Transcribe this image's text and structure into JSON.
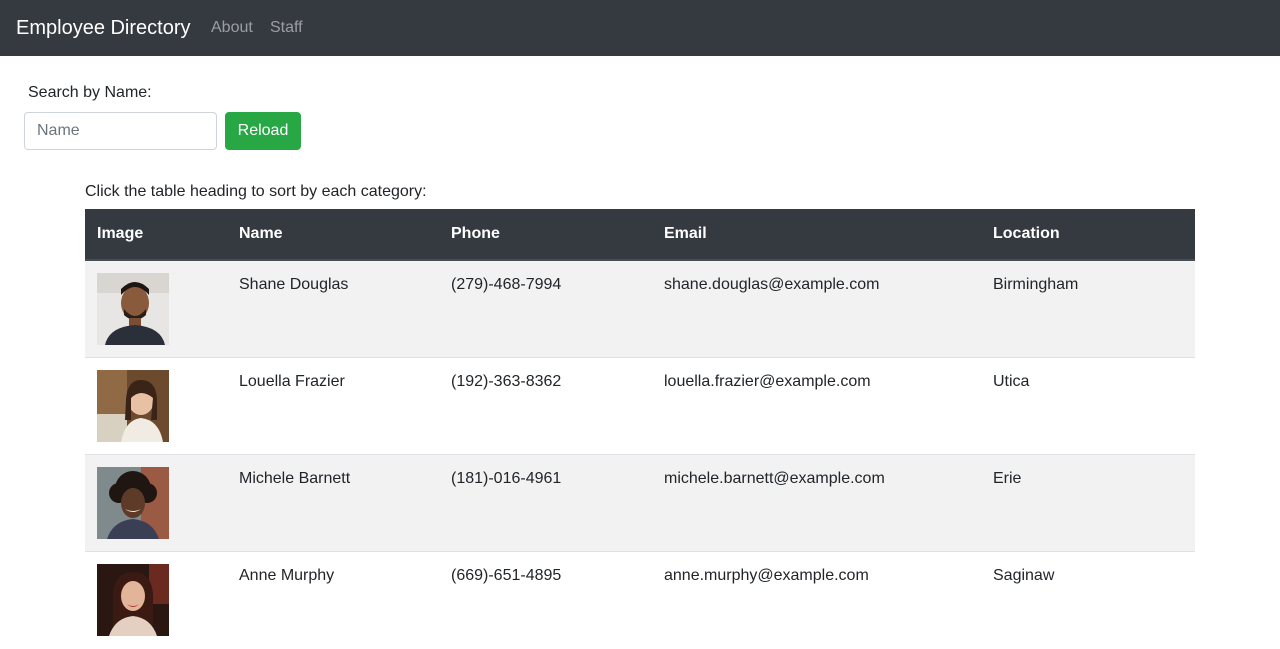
{
  "navbar": {
    "brand": "Employee Directory",
    "links": [
      {
        "label": "About"
      },
      {
        "label": "Staff"
      }
    ]
  },
  "search": {
    "label": "Search by Name:",
    "placeholder": "Name",
    "value": "",
    "reload_label": "Reload"
  },
  "instructions": "Click the table heading to sort by each category:",
  "table": {
    "headers": [
      "Image",
      "Name",
      "Phone",
      "Email",
      "Location"
    ],
    "rows": [
      {
        "name": "Shane Douglas",
        "phone": "(279)-468-7994",
        "email": "shane.douglas@example.com",
        "location": "Birmingham",
        "avatar_icon": "man-portrait-photo"
      },
      {
        "name": "Louella Frazier",
        "phone": "(192)-363-8362",
        "email": "louella.frazier@example.com",
        "location": "Utica",
        "avatar_icon": "woman-portrait-photo"
      },
      {
        "name": "Michele Barnett",
        "phone": "(181)-016-4961",
        "email": "michele.barnett@example.com",
        "location": "Erie",
        "avatar_icon": "woman-portrait-photo"
      },
      {
        "name": "Anne Murphy",
        "phone": "(669)-651-4895",
        "email": "anne.murphy@example.com",
        "location": "Saginaw",
        "avatar_icon": "woman-portrait-photo"
      }
    ]
  },
  "colors": {
    "navbar_bg": "#343a40",
    "reload_button": "#28a745",
    "striped_row": "#f2f2f2"
  }
}
